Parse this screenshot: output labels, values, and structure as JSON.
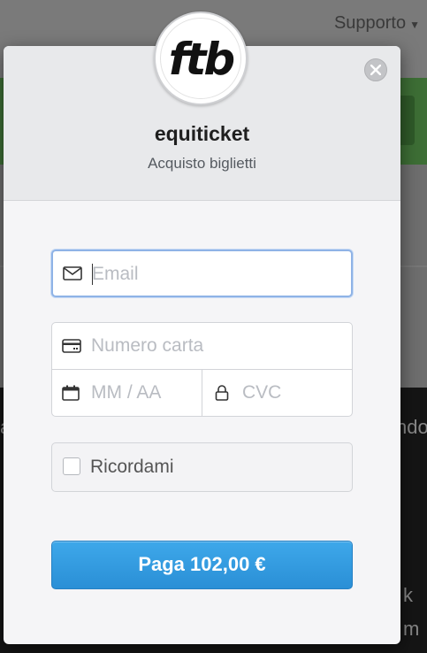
{
  "background": {
    "support_label": "Supporto",
    "dark_text_right": "ndo",
    "dark_text_left": "a",
    "dark_text_bottom_right": "m",
    "dark_text_mid_right": "k"
  },
  "modal": {
    "brand_logo_text": "ftb",
    "title": "equiticket",
    "subtitle": "Acquisto biglietti",
    "close_icon": "close-icon"
  },
  "form": {
    "email_placeholder": "Email",
    "card_placeholder": "Numero carta",
    "expiry_placeholder": "MM / AA",
    "cvc_placeholder": "CVC",
    "remember_label": "Ricordami",
    "pay_button": "Paga 102,00 €"
  },
  "colors": {
    "accent": "#2d95dc",
    "focus_border": "#8fb3e6"
  }
}
